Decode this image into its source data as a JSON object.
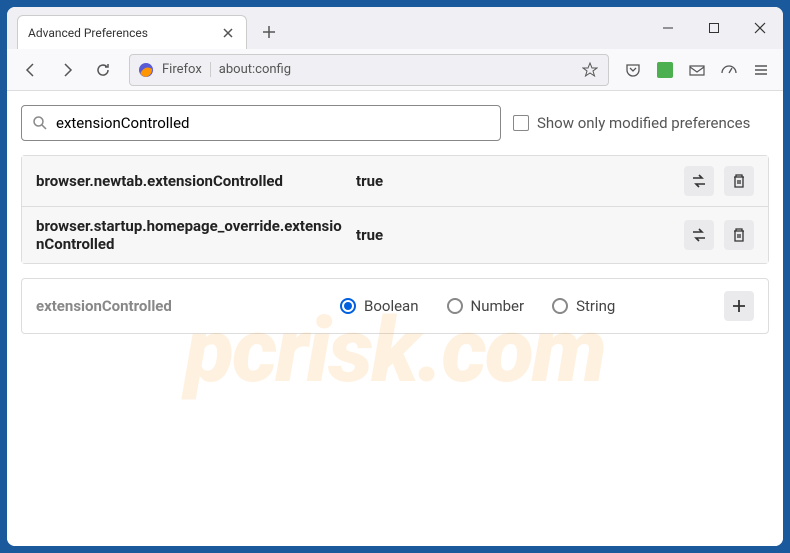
{
  "tab": {
    "title": "Advanced Preferences"
  },
  "address": {
    "identity": "Firefox",
    "url": "about:config"
  },
  "search": {
    "value": "extensionControlled",
    "checkbox_label": "Show only modified preferences"
  },
  "prefs": [
    {
      "name": "browser.newtab.extensionControlled",
      "value": "true"
    },
    {
      "name": "browser.startup.homepage_override.extensionControlled",
      "value": "true"
    }
  ],
  "new_pref": {
    "name": "extensionControlled",
    "types": {
      "boolean": "Boolean",
      "number": "Number",
      "string": "String"
    }
  },
  "watermark": "pcrisk.com"
}
